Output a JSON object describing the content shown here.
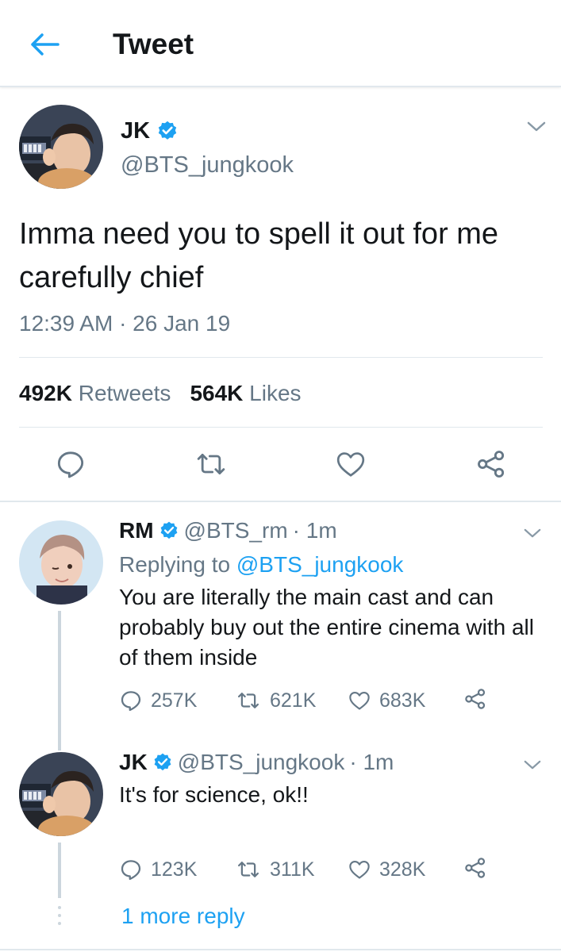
{
  "header": {
    "title": "Tweet"
  },
  "main_tweet": {
    "name": "JK",
    "handle": "@BTS_jungkook",
    "text": "Imma need you to spell it out for me carefully chief",
    "timestamp": "12:39 AM · 26 Jan 19",
    "retweets_count": "492K",
    "retweets_label": "Retweets",
    "likes_count": "564K",
    "likes_label": "Likes"
  },
  "replies": [
    {
      "name": "RM",
      "handle": "@BTS_rm",
      "time": "· 1m",
      "replying_prefix": "Replying to",
      "replying_handle": "@BTS_jungkook",
      "text": "You are literally the main cast and can probably buy out the entire cinema with all of them inside",
      "reply_count": "257K",
      "retweet_count": "621K",
      "like_count": "683K"
    },
    {
      "name": "JK",
      "handle": "@BTS_jungkook",
      "time": "· 1m",
      "text": "It's for science, ok!!",
      "reply_count": "123K",
      "retweet_count": "311K",
      "like_count": "328K"
    }
  ],
  "more_replies_label": "1 more reply",
  "colors": {
    "accent": "#1da1f2",
    "text": "#14171a",
    "secondary": "#657786",
    "border": "#e1e8ed"
  },
  "icons": [
    "back-arrow-icon",
    "verified-badge-icon",
    "chevron-down-icon",
    "reply-icon",
    "retweet-icon",
    "like-icon",
    "share-icon"
  ]
}
